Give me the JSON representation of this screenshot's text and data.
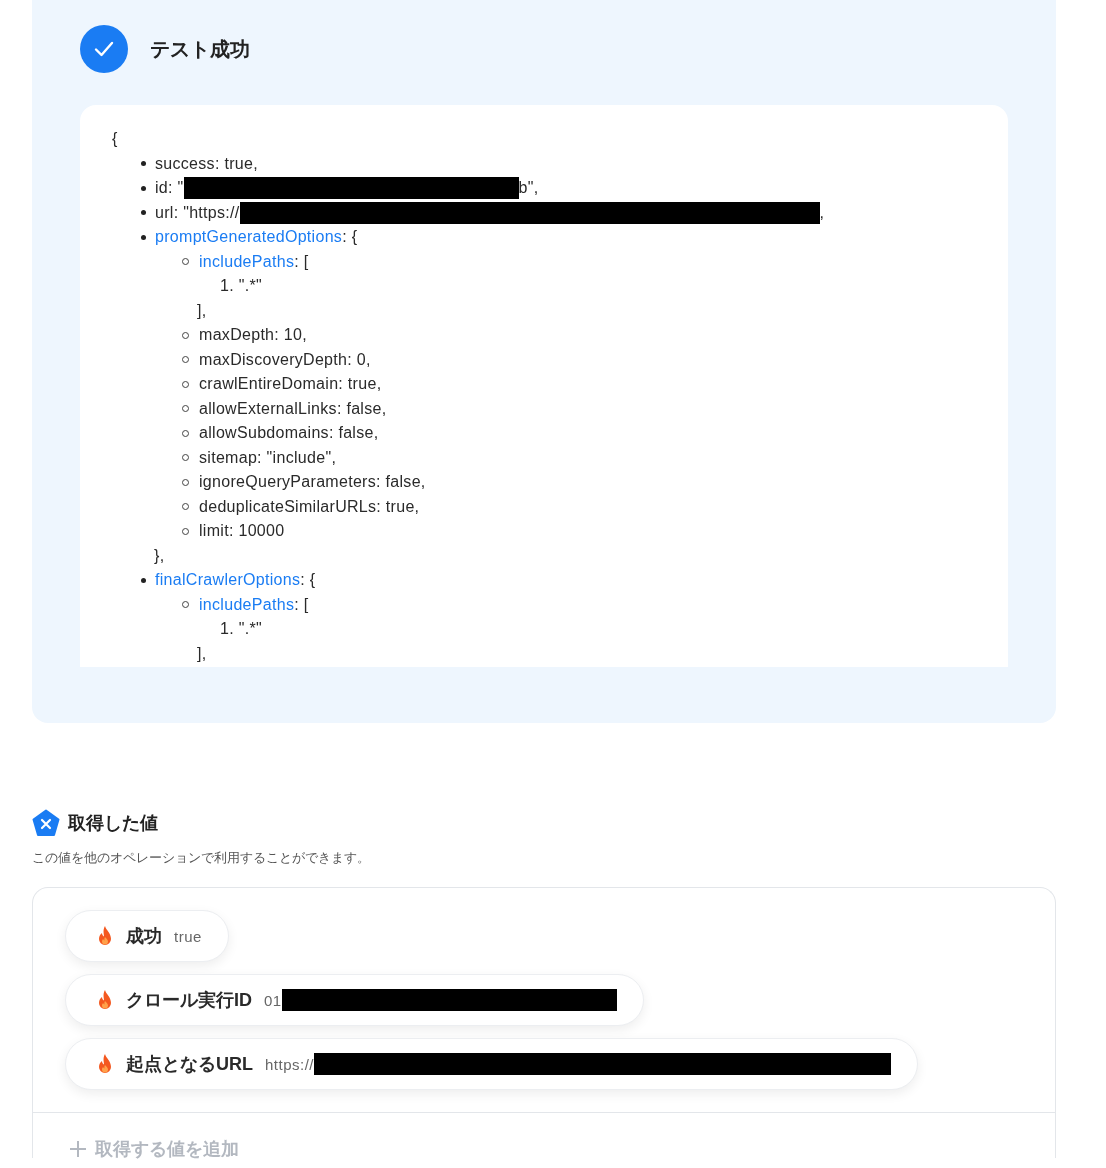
{
  "test_result": {
    "title": "テスト成功",
    "success": true,
    "response": {
      "open": "{",
      "items": [
        {
          "text": "success: true,"
        },
        {
          "text": "id: \"",
          "redacted": true,
          "tail": "b\","
        },
        {
          "text": "url: \"https://",
          "redacted": true,
          "tail": ","
        },
        {
          "key": "promptGeneratedOptions",
          "text": ": {",
          "close": "},",
          "children": [
            {
              "key": "includePaths",
              "text": ": [",
              "entries": [
                {
                  "number": "1.",
                  "text": "\".*\""
                }
              ],
              "close": "],"
            },
            {
              "text": "maxDepth: 10,"
            },
            {
              "text": "maxDiscoveryDepth: 0,"
            },
            {
              "text": "crawlEntireDomain: true,"
            },
            {
              "text": "allowExternalLinks: false,"
            },
            {
              "text": "allowSubdomains: false,"
            },
            {
              "text": "sitemap: \"include\","
            },
            {
              "text": "ignoreQueryParameters: false,"
            },
            {
              "text": "deduplicateSimilarURLs: true,"
            },
            {
              "text": "limit: 10000"
            }
          ]
        },
        {
          "key": "finalCrawlerOptions",
          "text": ": {",
          "children": [
            {
              "key": "includePaths",
              "text": ": [",
              "entries": [
                {
                  "number": "1.",
                  "text": "\".*\""
                }
              ],
              "close": "],"
            }
          ]
        }
      ]
    }
  },
  "retrieved_values": {
    "title": "取得した値",
    "description": "この値を他のオペレーションで利用することができます。",
    "values": [
      {
        "label": "成功",
        "value": "true",
        "redacted": false
      },
      {
        "label": "クロール実行ID",
        "value": "01",
        "redacted": true
      },
      {
        "label": "起点となるURL",
        "value": "https://",
        "redacted": true
      }
    ],
    "add_button": "取得する値を追加"
  }
}
